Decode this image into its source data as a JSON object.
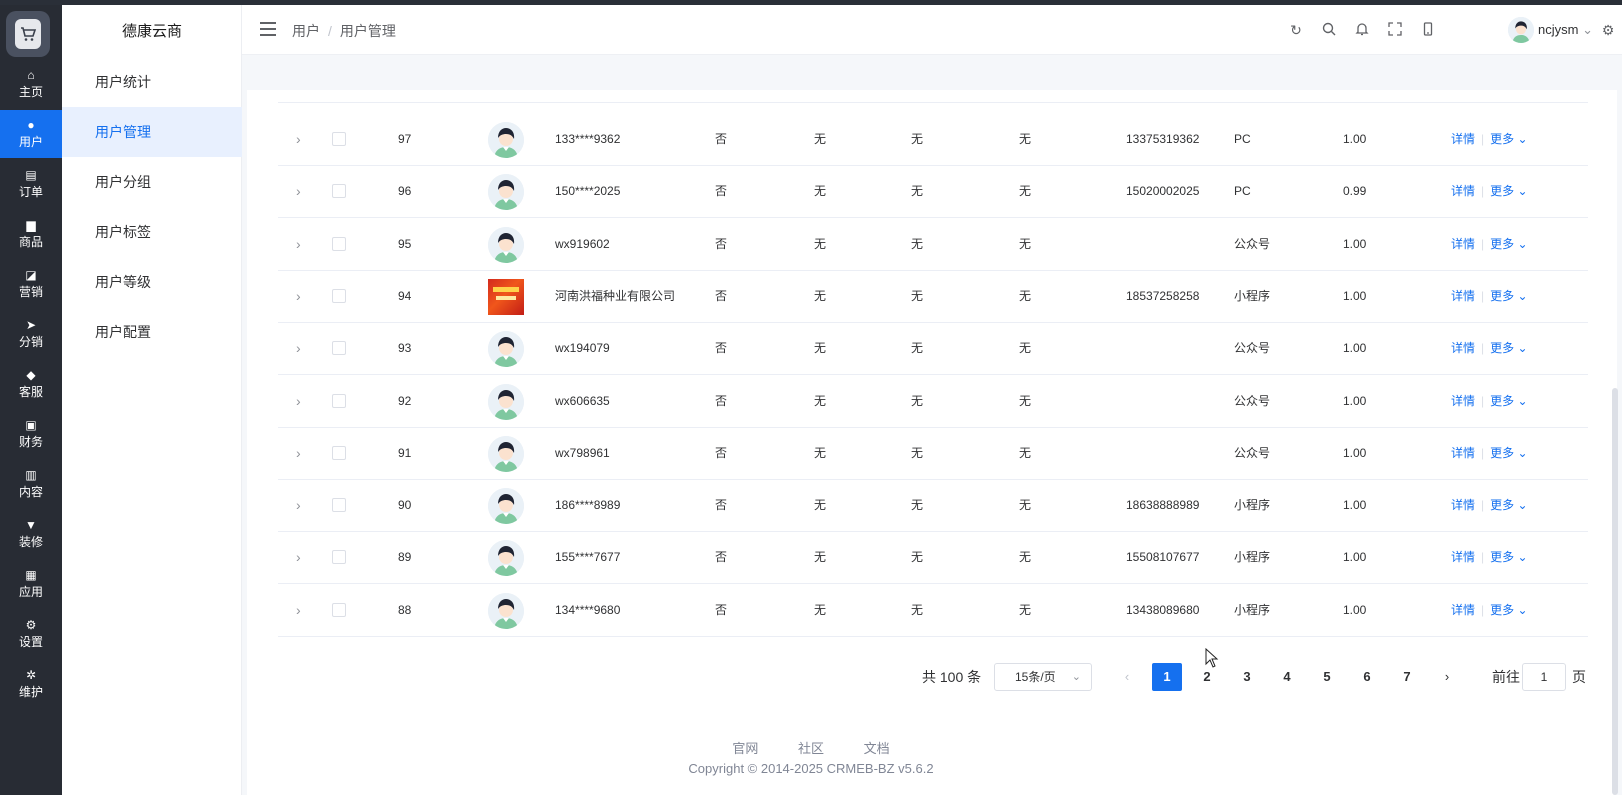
{
  "brand": "德康云商",
  "rail": [
    {
      "label": "主页",
      "icon": "home-icon",
      "glyph": "⌂"
    },
    {
      "label": "用户",
      "icon": "user-icon",
      "glyph": "●"
    },
    {
      "label": "订单",
      "icon": "order-icon",
      "glyph": "▤"
    },
    {
      "label": "商品",
      "icon": "product-icon",
      "glyph": "▆"
    },
    {
      "label": "营销",
      "icon": "marketing-icon",
      "glyph": "◪"
    },
    {
      "label": "分销",
      "icon": "send-icon",
      "glyph": "➤"
    },
    {
      "label": "客服",
      "icon": "bell-icon",
      "glyph": "◆"
    },
    {
      "label": "财务",
      "icon": "wallet-icon",
      "glyph": "▣"
    },
    {
      "label": "内容",
      "icon": "content-icon",
      "glyph": "▥"
    },
    {
      "label": "装修",
      "icon": "brush-icon",
      "glyph": "▼"
    },
    {
      "label": "应用",
      "icon": "apps-icon",
      "glyph": "▦"
    },
    {
      "label": "设置",
      "icon": "gear-icon",
      "glyph": "⚙"
    },
    {
      "label": "维护",
      "icon": "chip-icon",
      "glyph": "✲"
    }
  ],
  "submenu": [
    "用户统计",
    "用户管理",
    "用户分组",
    "用户标签",
    "用户等级",
    "用户配置"
  ],
  "breadcrumb": {
    "parent": "用户",
    "current": "用户管理"
  },
  "header": {
    "username": "ncjysm"
  },
  "table_rows": [
    {
      "id": "97",
      "name": "133****9362",
      "flag": "否",
      "c1": "无",
      "c2": "无",
      "c3": "无",
      "phone": "13375319362",
      "source": "PC",
      "balance": "1.00",
      "avatar": "person"
    },
    {
      "id": "96",
      "name": "150****2025",
      "flag": "否",
      "c1": "无",
      "c2": "无",
      "c3": "无",
      "phone": "15020002025",
      "source": "PC",
      "balance": "0.99",
      "avatar": "person"
    },
    {
      "id": "95",
      "name": "wx919602",
      "flag": "否",
      "c1": "无",
      "c2": "无",
      "c3": "无",
      "phone": "",
      "source": "公众号",
      "balance": "1.00",
      "avatar": "person"
    },
    {
      "id": "94",
      "name": "河南洪福种业有限公司",
      "flag": "否",
      "c1": "无",
      "c2": "无",
      "c3": "无",
      "phone": "18537258258",
      "source": "小程序",
      "balance": "1.00",
      "avatar": "image"
    },
    {
      "id": "93",
      "name": "wx194079",
      "flag": "否",
      "c1": "无",
      "c2": "无",
      "c3": "无",
      "phone": "",
      "source": "公众号",
      "balance": "1.00",
      "avatar": "person"
    },
    {
      "id": "92",
      "name": "wx606635",
      "flag": "否",
      "c1": "无",
      "c2": "无",
      "c3": "无",
      "phone": "",
      "source": "公众号",
      "balance": "1.00",
      "avatar": "person"
    },
    {
      "id": "91",
      "name": "wx798961",
      "flag": "否",
      "c1": "无",
      "c2": "无",
      "c3": "无",
      "phone": "",
      "source": "公众号",
      "balance": "1.00",
      "avatar": "person"
    },
    {
      "id": "90",
      "name": "186****8989",
      "flag": "否",
      "c1": "无",
      "c2": "无",
      "c3": "无",
      "phone": "18638888989",
      "source": "小程序",
      "balance": "1.00",
      "avatar": "person"
    },
    {
      "id": "89",
      "name": "155****7677",
      "flag": "否",
      "c1": "无",
      "c2": "无",
      "c3": "无",
      "phone": "15508107677",
      "source": "小程序",
      "balance": "1.00",
      "avatar": "person"
    },
    {
      "id": "88",
      "name": "134****9680",
      "flag": "否",
      "c1": "无",
      "c2": "无",
      "c3": "无",
      "phone": "13438089680",
      "source": "小程序",
      "balance": "1.00",
      "avatar": "person"
    }
  ],
  "row_actions": {
    "detail": "详情",
    "more": "更多"
  },
  "pagination": {
    "total": "共 100 条",
    "page_size": "15条/页",
    "pages": [
      "1",
      "2",
      "3",
      "4",
      "5",
      "6",
      "7"
    ],
    "current": "1",
    "goto_label": "前往",
    "goto_value": "1",
    "page_suffix": "页"
  },
  "footer": {
    "links": [
      "官网",
      "社区",
      "文档"
    ],
    "copyright": "Copyright © 2014-2025 CRMEB-BZ v5.6.2"
  }
}
